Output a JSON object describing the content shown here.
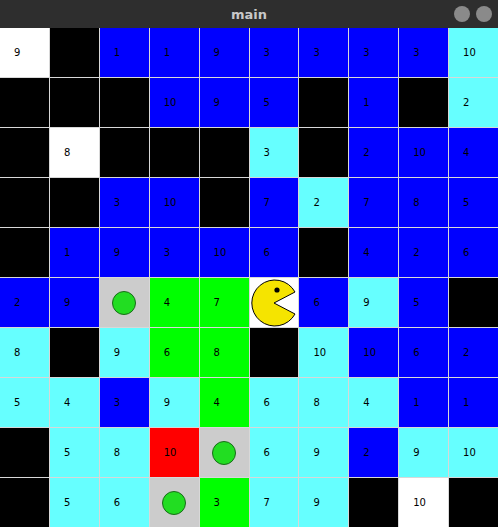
{
  "window": {
    "title": "main"
  },
  "grid": {
    "rows": [
      [
        {
          "kind": "tile",
          "color": "#ffffff",
          "label": "9"
        },
        {
          "kind": "wall",
          "color": "#000000",
          "label": ""
        },
        {
          "kind": "tile",
          "color": "#0000ff",
          "label": "1"
        },
        {
          "kind": "tile",
          "color": "#0000ff",
          "label": "1"
        },
        {
          "kind": "tile",
          "color": "#0000ff",
          "label": "9"
        },
        {
          "kind": "tile",
          "color": "#0000ff",
          "label": "3"
        },
        {
          "kind": "tile",
          "color": "#0000ff",
          "label": "3"
        },
        {
          "kind": "tile",
          "color": "#0000ff",
          "label": "3"
        },
        {
          "kind": "tile",
          "color": "#0000ff",
          "label": "3"
        },
        {
          "kind": "tile",
          "color": "#66ffff",
          "label": "10"
        }
      ],
      [
        {
          "kind": "wall",
          "color": "#000000",
          "label": ""
        },
        {
          "kind": "wall",
          "color": "#000000",
          "label": ""
        },
        {
          "kind": "wall",
          "color": "#000000",
          "label": ""
        },
        {
          "kind": "tile",
          "color": "#0000ff",
          "label": "10"
        },
        {
          "kind": "tile",
          "color": "#0000ff",
          "label": "9"
        },
        {
          "kind": "tile",
          "color": "#0000ff",
          "label": "5"
        },
        {
          "kind": "wall",
          "color": "#000000",
          "label": ""
        },
        {
          "kind": "tile",
          "color": "#0000ff",
          "label": "1"
        },
        {
          "kind": "wall",
          "color": "#000000",
          "label": ""
        },
        {
          "kind": "tile",
          "color": "#66ffff",
          "label": "2"
        }
      ],
      [
        {
          "kind": "wall",
          "color": "#000000",
          "label": ""
        },
        {
          "kind": "tile",
          "color": "#ffffff",
          "label": "8"
        },
        {
          "kind": "wall",
          "color": "#000000",
          "label": ""
        },
        {
          "kind": "wall",
          "color": "#000000",
          "label": ""
        },
        {
          "kind": "wall",
          "color": "#000000",
          "label": ""
        },
        {
          "kind": "tile",
          "color": "#66ffff",
          "label": "3"
        },
        {
          "kind": "wall",
          "color": "#000000",
          "label": ""
        },
        {
          "kind": "tile",
          "color": "#0000ff",
          "label": "2"
        },
        {
          "kind": "tile",
          "color": "#0000ff",
          "label": "10"
        },
        {
          "kind": "tile",
          "color": "#0000ff",
          "label": "4"
        }
      ],
      [
        {
          "kind": "wall",
          "color": "#000000",
          "label": ""
        },
        {
          "kind": "wall",
          "color": "#000000",
          "label": ""
        },
        {
          "kind": "tile",
          "color": "#0000ff",
          "label": "3"
        },
        {
          "kind": "tile",
          "color": "#0000ff",
          "label": "10"
        },
        {
          "kind": "wall",
          "color": "#000000",
          "label": ""
        },
        {
          "kind": "tile",
          "color": "#0000ff",
          "label": "7"
        },
        {
          "kind": "tile",
          "color": "#66ffff",
          "label": "2"
        },
        {
          "kind": "tile",
          "color": "#0000ff",
          "label": "7"
        },
        {
          "kind": "tile",
          "color": "#0000ff",
          "label": "8"
        },
        {
          "kind": "tile",
          "color": "#0000ff",
          "label": "5"
        }
      ],
      [
        {
          "kind": "wall",
          "color": "#000000",
          "label": ""
        },
        {
          "kind": "tile",
          "color": "#0000ff",
          "label": "1"
        },
        {
          "kind": "tile",
          "color": "#0000ff",
          "label": "9"
        },
        {
          "kind": "tile",
          "color": "#0000ff",
          "label": "3"
        },
        {
          "kind": "tile",
          "color": "#0000ff",
          "label": "10"
        },
        {
          "kind": "tile",
          "color": "#0000ff",
          "label": "6"
        },
        {
          "kind": "wall",
          "color": "#000000",
          "label": ""
        },
        {
          "kind": "tile",
          "color": "#0000ff",
          "label": "4"
        },
        {
          "kind": "tile",
          "color": "#0000ff",
          "label": "2"
        },
        {
          "kind": "tile",
          "color": "#0000ff",
          "label": "6"
        }
      ],
      [
        {
          "kind": "tile",
          "color": "#0000ff",
          "label": "2"
        },
        {
          "kind": "tile",
          "color": "#0000ff",
          "label": "9"
        },
        {
          "kind": "dot",
          "color": "#cccccc",
          "label": ""
        },
        {
          "kind": "tile",
          "color": "#00ff00",
          "label": "4"
        },
        {
          "kind": "tile",
          "color": "#00ff00",
          "label": "7"
        },
        {
          "kind": "pacman",
          "color": "#ffffff",
          "label": ""
        },
        {
          "kind": "tile",
          "color": "#0000ff",
          "label": "6"
        },
        {
          "kind": "tile",
          "color": "#66ffff",
          "label": "9"
        },
        {
          "kind": "tile",
          "color": "#0000ff",
          "label": "5"
        },
        {
          "kind": "wall",
          "color": "#000000",
          "label": ""
        }
      ],
      [
        {
          "kind": "tile",
          "color": "#66ffff",
          "label": "8"
        },
        {
          "kind": "wall",
          "color": "#000000",
          "label": ""
        },
        {
          "kind": "tile",
          "color": "#66ffff",
          "label": "9"
        },
        {
          "kind": "tile",
          "color": "#00ff00",
          "label": "6"
        },
        {
          "kind": "tile",
          "color": "#00ff00",
          "label": "8"
        },
        {
          "kind": "wall",
          "color": "#000000",
          "label": ""
        },
        {
          "kind": "tile",
          "color": "#66ffff",
          "label": "10"
        },
        {
          "kind": "tile",
          "color": "#0000ff",
          "label": "10"
        },
        {
          "kind": "tile",
          "color": "#0000ff",
          "label": "6"
        },
        {
          "kind": "tile",
          "color": "#0000ff",
          "label": "2"
        }
      ],
      [
        {
          "kind": "tile",
          "color": "#66ffff",
          "label": "5"
        },
        {
          "kind": "tile",
          "color": "#66ffff",
          "label": "4"
        },
        {
          "kind": "tile",
          "color": "#0000ff",
          "label": "3"
        },
        {
          "kind": "tile",
          "color": "#66ffff",
          "label": "9"
        },
        {
          "kind": "tile",
          "color": "#00ff00",
          "label": "4"
        },
        {
          "kind": "tile",
          "color": "#66ffff",
          "label": "6"
        },
        {
          "kind": "tile",
          "color": "#66ffff",
          "label": "8"
        },
        {
          "kind": "tile",
          "color": "#66ffff",
          "label": "4"
        },
        {
          "kind": "tile",
          "color": "#0000ff",
          "label": "1"
        },
        {
          "kind": "tile",
          "color": "#0000ff",
          "label": "1"
        }
      ],
      [
        {
          "kind": "wall",
          "color": "#000000",
          "label": ""
        },
        {
          "kind": "tile",
          "color": "#66ffff",
          "label": "5"
        },
        {
          "kind": "tile",
          "color": "#66ffff",
          "label": "8"
        },
        {
          "kind": "tile",
          "color": "#ff0000",
          "label": "10"
        },
        {
          "kind": "dot",
          "color": "#cccccc",
          "label": ""
        },
        {
          "kind": "tile",
          "color": "#66ffff",
          "label": "6"
        },
        {
          "kind": "tile",
          "color": "#66ffff",
          "label": "9"
        },
        {
          "kind": "tile",
          "color": "#0000ff",
          "label": "2"
        },
        {
          "kind": "tile",
          "color": "#66ffff",
          "label": "9"
        },
        {
          "kind": "tile",
          "color": "#66ffff",
          "label": "10"
        }
      ],
      [
        {
          "kind": "wall",
          "color": "#000000",
          "label": ""
        },
        {
          "kind": "tile",
          "color": "#66ffff",
          "label": "5"
        },
        {
          "kind": "tile",
          "color": "#66ffff",
          "label": "6"
        },
        {
          "kind": "dot",
          "color": "#cccccc",
          "label": ""
        },
        {
          "kind": "tile",
          "color": "#00ff00",
          "label": "3"
        },
        {
          "kind": "tile",
          "color": "#66ffff",
          "label": "7"
        },
        {
          "kind": "tile",
          "color": "#66ffff",
          "label": "9"
        },
        {
          "kind": "wall",
          "color": "#000000",
          "label": ""
        },
        {
          "kind": "tile",
          "color": "#ffffff",
          "label": "10"
        },
        {
          "kind": "wall",
          "color": "#000000",
          "label": ""
        }
      ]
    ]
  }
}
